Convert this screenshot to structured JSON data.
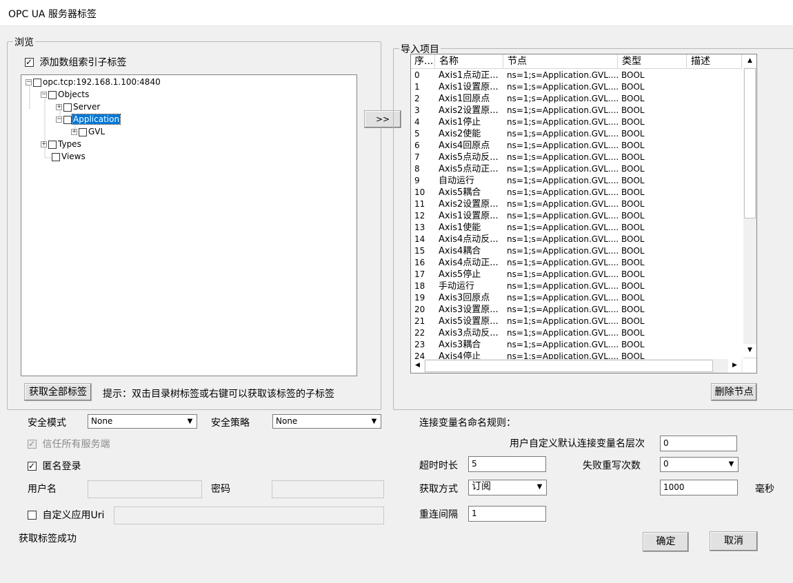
{
  "window": {
    "title": "OPC UA 服务器标签"
  },
  "browse": {
    "legend": "浏览",
    "add_array_index_label": "添加数组索引子标签",
    "tree": {
      "root": "opc.tcp:192.168.1.100:4840",
      "objects": "Objects",
      "server": "Server",
      "application": "Application",
      "gvl": "GVL",
      "types": "Types",
      "views": "Views"
    },
    "get_all_button": "获取全部标签",
    "hint": "提示：双击目录树标签或右键可以获取该标签的子标签"
  },
  "transfer_button": ">>",
  "import": {
    "legend": "导入项目",
    "columns": [
      "序...",
      "名称",
      "节点",
      "类型",
      "描述"
    ],
    "rows": [
      [
        "0",
        "Axis1点动正...",
        "ns=1;s=Application.GVL....",
        "BOOL",
        ""
      ],
      [
        "1",
        "Axis1设置原...",
        "ns=1;s=Application.GVL....",
        "BOOL",
        ""
      ],
      [
        "2",
        "Axis1回原点",
        "ns=1;s=Application.GVL....",
        "BOOL",
        ""
      ],
      [
        "3",
        "Axis2设置原...",
        "ns=1;s=Application.GVL....",
        "BOOL",
        ""
      ],
      [
        "4",
        "Axis1停止",
        "ns=1;s=Application.GVL....",
        "BOOL",
        ""
      ],
      [
        "5",
        "Axis2使能",
        "ns=1;s=Application.GVL....",
        "BOOL",
        ""
      ],
      [
        "6",
        "Axis4回原点",
        "ns=1;s=Application.GVL....",
        "BOOL",
        ""
      ],
      [
        "7",
        "Axis5点动反...",
        "ns=1;s=Application.GVL....",
        "BOOL",
        ""
      ],
      [
        "8",
        "Axis5点动正...",
        "ns=1;s=Application.GVL....",
        "BOOL",
        ""
      ],
      [
        "9",
        "自动运行",
        "ns=1;s=Application.GVL....",
        "BOOL",
        ""
      ],
      [
        "10",
        "Axis5耦合",
        "ns=1;s=Application.GVL....",
        "BOOL",
        ""
      ],
      [
        "11",
        "Axis2设置原...",
        "ns=1;s=Application.GVL....",
        "BOOL",
        ""
      ],
      [
        "12",
        "Axis1设置原...",
        "ns=1;s=Application.GVL....",
        "BOOL",
        ""
      ],
      [
        "13",
        "Axis1使能",
        "ns=1;s=Application.GVL....",
        "BOOL",
        ""
      ],
      [
        "14",
        "Axis4点动反...",
        "ns=1;s=Application.GVL....",
        "BOOL",
        ""
      ],
      [
        "15",
        "Axis4耦合",
        "ns=1;s=Application.GVL....",
        "BOOL",
        ""
      ],
      [
        "16",
        "Axis4点动正...",
        "ns=1;s=Application.GVL....",
        "BOOL",
        ""
      ],
      [
        "17",
        "Axis5停止",
        "ns=1;s=Application.GVL....",
        "BOOL",
        ""
      ],
      [
        "18",
        "手动运行",
        "ns=1;s=Application.GVL....",
        "BOOL",
        ""
      ],
      [
        "19",
        "Axis3回原点",
        "ns=1;s=Application.GVL....",
        "BOOL",
        ""
      ],
      [
        "20",
        "Axis3设置原...",
        "ns=1;s=Application.GVL....",
        "BOOL",
        ""
      ],
      [
        "21",
        "Axis5设置原...",
        "ns=1;s=Application.GVL....",
        "BOOL",
        ""
      ],
      [
        "22",
        "Axis3点动反...",
        "ns=1;s=Application.GVL....",
        "BOOL",
        ""
      ],
      [
        "23",
        "Axis3耦合",
        "ns=1;s=Application.GVL....",
        "BOOL",
        ""
      ],
      [
        "24",
        "Axis4停止",
        "ns=1;s=Application.GVL....",
        "BOOL",
        ""
      ]
    ],
    "delete_button": "删除节点"
  },
  "security": {
    "mode_label": "安全模式",
    "mode_value": "None",
    "policy_label": "安全策略",
    "policy_value": "None",
    "trust_all_label": "信任所有服务端",
    "anonymous_label": "匿名登录",
    "username_label": "用户名",
    "password_label": "密码",
    "custom_uri_label": "自定义应用Uri"
  },
  "connection": {
    "naming_rule_label": "连接变量名命名规则：",
    "level_label": "用户自定义默认连接变量名层次",
    "level_value": "0",
    "timeout_label": "超时时长",
    "timeout_value": "5",
    "retry_label": "失败重写次数",
    "retry_value": "0",
    "fetch_label": "获取方式",
    "fetch_value": "订阅",
    "interval_value": "1000",
    "interval_unit": "毫秒",
    "reconnect_label": "重连间隔",
    "reconnect_value": "1"
  },
  "status": {
    "message": "获取标签成功"
  },
  "footer": {
    "ok_button": "确定",
    "cancel_button": "取消"
  }
}
